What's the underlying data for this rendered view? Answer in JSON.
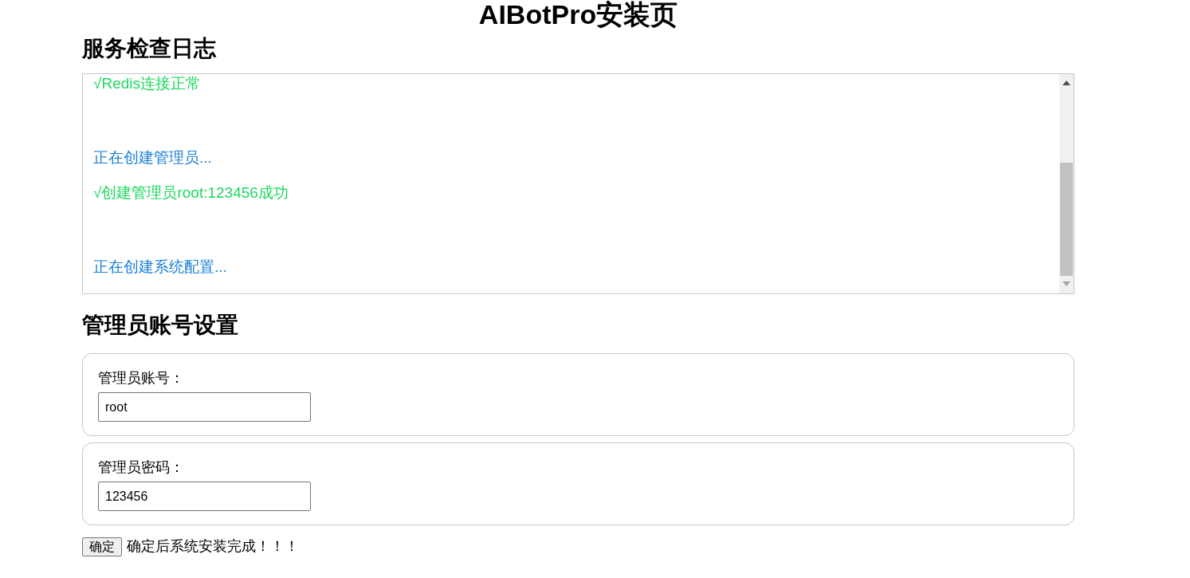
{
  "page_title": "AIBotPro安装页",
  "log_section": {
    "heading": "服务检查日志",
    "entries": [
      {
        "kind": "success",
        "text": "√Redis连接正常"
      },
      {
        "kind": "gap"
      },
      {
        "kind": "info",
        "text": "正在创建管理员..."
      },
      {
        "kind": "success",
        "text": "√创建管理员root:123456成功"
      },
      {
        "kind": "gap"
      },
      {
        "kind": "info",
        "text": "正在创建系统配置..."
      }
    ]
  },
  "admin_section": {
    "heading": "管理员账号设置",
    "fields": [
      {
        "label": "管理员账号：",
        "value": "root"
      },
      {
        "label": "管理员密码：",
        "value": "123456"
      }
    ]
  },
  "confirm_button": "确定",
  "confirm_note": "确定后系统安装完成！！！"
}
